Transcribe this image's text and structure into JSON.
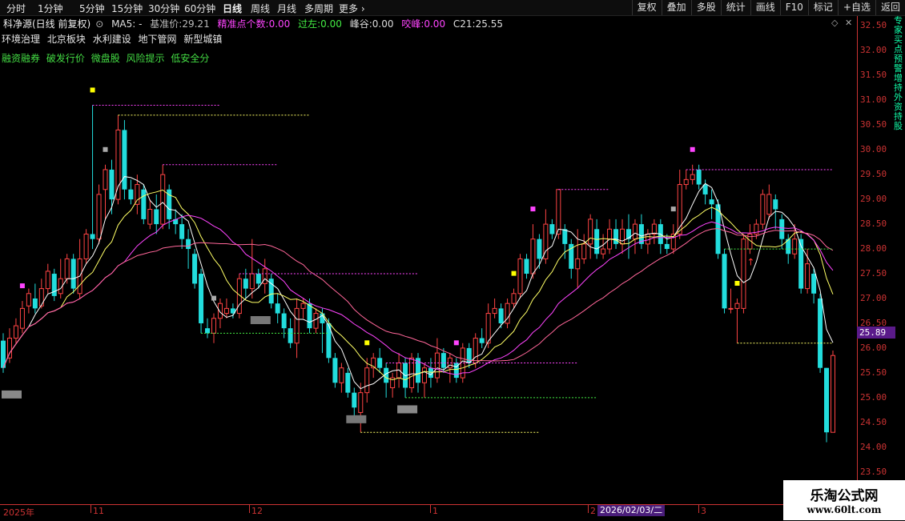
{
  "toolbar": {
    "periods": [
      "分时",
      "1分钟",
      "5分钟",
      "15分钟",
      "30分钟",
      "60分钟",
      "日线",
      "周线",
      "月线",
      "多周期",
      "更多"
    ],
    "buttons": [
      "复权",
      "叠加",
      "多股",
      "统计",
      "画线",
      "F10",
      "标记",
      "+自选",
      "返回"
    ]
  },
  "info": {
    "stock": "科净源(日线 前复权)",
    "ma5": "MA5: -",
    "base_label": "基准价:",
    "base_value": "29.21",
    "precise_label": "精准点个数:",
    "precise_value": "0.00",
    "over_label": "过左:",
    "over_value": "0.00",
    "peak_label": "峰谷:",
    "peak_value": "0.00",
    "bite_label": "咬峰:",
    "bite_value": "0.00",
    "c21_label": "C21:",
    "c21_value": "25.55"
  },
  "tags": [
    "环境治理",
    "北京板块",
    "水利建设",
    "地下管网",
    "新型城镇"
  ],
  "tags2": [
    "融资融券",
    "破发行价",
    "微盘股",
    "风险提示",
    "低安全分"
  ],
  "yaxis": [
    "32.50",
    "32.00",
    "31.50",
    "31.00",
    "30.50",
    "30.00",
    "29.50",
    "29.00",
    "28.50",
    "28.00",
    "27.50",
    "27.00",
    "26.50",
    "26.00",
    "25.50",
    "25.00",
    "24.50",
    "24.00",
    "23.50",
    "23.00"
  ],
  "current_price": "25.89",
  "xaxis": {
    "labels": [
      "2025年",
      "11",
      "12",
      "1",
      "2",
      "3"
    ],
    "highlight": "2026/02/03/二"
  },
  "side_text": "专家买点预警增持外资持股",
  "watermark": {
    "line1": "乐淘公式网",
    "line2": "www.60lt.com"
  },
  "colors": {
    "up": "#ff4444",
    "down": "#22dddd",
    "ma5": "#ffffff",
    "ma10": "#ffff66",
    "ma20": "#ff44ff",
    "ma30": "#ff6699"
  },
  "chart_data": {
    "type": "candlestick",
    "ylim": [
      22.85,
      32.7
    ],
    "candles": [
      {
        "o": 26.15,
        "c": 25.6,
        "h": 26.3,
        "l": 25.5
      },
      {
        "o": 25.8,
        "c": 26.2,
        "h": 26.4,
        "l": 25.7
      },
      {
        "o": 26.2,
        "c": 26.45,
        "h": 26.6,
        "l": 26.1
      },
      {
        "o": 26.4,
        "c": 26.8,
        "h": 26.95,
        "l": 26.3
      },
      {
        "o": 26.85,
        "c": 27.1,
        "h": 27.2,
        "l": 26.7
      },
      {
        "o": 27.0,
        "c": 26.8,
        "h": 27.3,
        "l": 26.7
      },
      {
        "o": 26.85,
        "c": 27.2,
        "h": 27.4,
        "l": 26.8
      },
      {
        "o": 27.2,
        "c": 27.55,
        "h": 27.7,
        "l": 27.1
      },
      {
        "o": 27.5,
        "c": 27.05,
        "h": 27.6,
        "l": 26.95
      },
      {
        "o": 27.1,
        "c": 27.4,
        "h": 27.8,
        "l": 27.0
      },
      {
        "o": 27.4,
        "c": 27.8,
        "h": 27.9,
        "l": 27.3
      },
      {
        "o": 27.8,
        "c": 27.2,
        "h": 27.9,
        "l": 27.1
      },
      {
        "o": 27.1,
        "c": 27.8,
        "h": 28.2,
        "l": 27.0
      },
      {
        "o": 27.8,
        "c": 28.3,
        "h": 28.4,
        "l": 27.7
      },
      {
        "o": 28.3,
        "c": 28.2,
        "h": 30.9,
        "l": 28.0
      },
      {
        "o": 28.2,
        "c": 29.1,
        "h": 29.3,
        "l": 28.1
      },
      {
        "o": 29.2,
        "c": 29.6,
        "h": 29.7,
        "l": 28.6
      },
      {
        "o": 29.6,
        "c": 29.0,
        "h": 29.8,
        "l": 28.7
      },
      {
        "o": 29.0,
        "c": 30.4,
        "h": 30.7,
        "l": 28.9
      },
      {
        "o": 30.4,
        "c": 29.2,
        "h": 30.6,
        "l": 29.0
      },
      {
        "o": 29.2,
        "c": 29.0,
        "h": 29.4,
        "l": 28.9
      },
      {
        "o": 28.9,
        "c": 29.3,
        "h": 29.5,
        "l": 28.7
      },
      {
        "o": 29.2,
        "c": 28.6,
        "h": 29.3,
        "l": 28.5
      },
      {
        "o": 28.5,
        "c": 28.8,
        "h": 29.0,
        "l": 28.4
      },
      {
        "o": 28.8,
        "c": 28.5,
        "h": 29.1,
        "l": 28.3
      },
      {
        "o": 28.5,
        "c": 29.5,
        "h": 29.7,
        "l": 28.4
      },
      {
        "o": 29.2,
        "c": 28.6,
        "h": 29.3,
        "l": 28.4
      },
      {
        "o": 28.6,
        "c": 28.5,
        "h": 28.8,
        "l": 28.3
      },
      {
        "o": 28.5,
        "c": 28.2,
        "h": 28.7,
        "l": 28.0
      },
      {
        "o": 28.2,
        "c": 28.0,
        "h": 28.4,
        "l": 27.6
      },
      {
        "o": 27.9,
        "c": 27.3,
        "h": 28.0,
        "l": 27.2
      },
      {
        "o": 27.5,
        "c": 26.5,
        "h": 27.6,
        "l": 26.3
      },
      {
        "o": 26.4,
        "c": 26.3,
        "h": 26.6,
        "l": 26.2
      },
      {
        "o": 26.3,
        "c": 26.6,
        "h": 26.7,
        "l": 26.1
      },
      {
        "o": 26.6,
        "c": 26.9,
        "h": 27.0,
        "l": 26.4
      },
      {
        "o": 26.7,
        "c": 26.8,
        "h": 27.0,
        "l": 26.6
      },
      {
        "o": 26.8,
        "c": 26.7,
        "h": 26.9,
        "l": 26.6
      },
      {
        "o": 26.7,
        "c": 27.4,
        "h": 27.5,
        "l": 26.6
      },
      {
        "o": 27.4,
        "c": 27.2,
        "h": 27.6,
        "l": 27.0
      },
      {
        "o": 27.2,
        "c": 27.5,
        "h": 28.2,
        "l": 27.0
      },
      {
        "o": 27.5,
        "c": 27.3,
        "h": 27.6,
        "l": 27.2
      },
      {
        "o": 27.3,
        "c": 27.6,
        "h": 27.8,
        "l": 27.1
      },
      {
        "o": 27.4,
        "c": 26.9,
        "h": 27.5,
        "l": 26.8
      },
      {
        "o": 26.9,
        "c": 26.7,
        "h": 27.1,
        "l": 26.5
      },
      {
        "o": 26.7,
        "c": 26.4,
        "h": 26.8,
        "l": 26.2
      },
      {
        "o": 26.4,
        "c": 26.1,
        "h": 26.6,
        "l": 26.0
      },
      {
        "o": 26.1,
        "c": 26.8,
        "h": 27.0,
        "l": 25.8
      },
      {
        "o": 26.8,
        "c": 26.9,
        "h": 27.0,
        "l": 26.6
      },
      {
        "o": 26.9,
        "c": 26.4,
        "h": 27.0,
        "l": 26.3
      },
      {
        "o": 26.4,
        "c": 26.7,
        "h": 26.8,
        "l": 26.3
      },
      {
        "o": 26.7,
        "c": 26.5,
        "h": 26.8,
        "l": 25.9
      },
      {
        "o": 26.5,
        "c": 25.8,
        "h": 26.6,
        "l": 25.7
      },
      {
        "o": 25.8,
        "c": 25.3,
        "h": 25.9,
        "l": 25.2
      },
      {
        "o": 25.3,
        "c": 25.6,
        "h": 25.7,
        "l": 25.1
      },
      {
        "o": 25.5,
        "c": 25.1,
        "h": 25.6,
        "l": 25.0
      },
      {
        "o": 25.1,
        "c": 24.8,
        "h": 25.2,
        "l": 24.6
      },
      {
        "o": 24.7,
        "c": 25.1,
        "h": 25.3,
        "l": 24.3
      },
      {
        "o": 25.1,
        "c": 25.6,
        "h": 25.8,
        "l": 24.9
      },
      {
        "o": 25.6,
        "c": 25.8,
        "h": 25.9,
        "l": 25.4
      },
      {
        "o": 25.8,
        "c": 25.6,
        "h": 26.0,
        "l": 25.5
      },
      {
        "o": 25.6,
        "c": 25.3,
        "h": 25.7,
        "l": 25.0
      },
      {
        "o": 25.2,
        "c": 25.4,
        "h": 25.5,
        "l": 25.0
      },
      {
        "o": 25.4,
        "c": 25.7,
        "h": 25.9,
        "l": 25.2
      },
      {
        "o": 25.7,
        "c": 25.2,
        "h": 25.8,
        "l": 25.0
      },
      {
        "o": 25.2,
        "c": 25.8,
        "h": 25.9,
        "l": 25.1
      },
      {
        "o": 25.8,
        "c": 25.3,
        "h": 25.9,
        "l": 25.1
      },
      {
        "o": 25.3,
        "c": 25.6,
        "h": 25.7,
        "l": 25.0
      },
      {
        "o": 25.6,
        "c": 25.4,
        "h": 25.8,
        "l": 25.2
      },
      {
        "o": 25.4,
        "c": 25.9,
        "h": 26.2,
        "l": 25.3
      },
      {
        "o": 25.9,
        "c": 25.6,
        "h": 26.0,
        "l": 25.5
      },
      {
        "o": 25.6,
        "c": 25.8,
        "h": 25.9,
        "l": 25.3
      },
      {
        "o": 25.7,
        "c": 25.4,
        "h": 25.8,
        "l": 25.3
      },
      {
        "o": 25.4,
        "c": 26.0,
        "h": 26.1,
        "l": 25.3
      },
      {
        "o": 26.0,
        "c": 25.7,
        "h": 26.1,
        "l": 25.6
      },
      {
        "o": 25.7,
        "c": 26.2,
        "h": 26.3,
        "l": 25.6
      },
      {
        "o": 26.2,
        "c": 26.1,
        "h": 26.4,
        "l": 26.0
      },
      {
        "o": 26.1,
        "c": 26.7,
        "h": 26.9,
        "l": 26.0
      },
      {
        "o": 26.7,
        "c": 26.8,
        "h": 27.0,
        "l": 26.6
      },
      {
        "o": 26.8,
        "c": 26.5,
        "h": 26.9,
        "l": 26.4
      },
      {
        "o": 26.5,
        "c": 26.9,
        "h": 27.0,
        "l": 26.4
      },
      {
        "o": 26.9,
        "c": 27.1,
        "h": 27.2,
        "l": 26.8
      },
      {
        "o": 27.1,
        "c": 27.8,
        "h": 27.9,
        "l": 27.0
      },
      {
        "o": 27.8,
        "c": 27.5,
        "h": 27.9,
        "l": 27.4
      },
      {
        "o": 27.5,
        "c": 28.2,
        "h": 28.5,
        "l": 27.4
      },
      {
        "o": 28.2,
        "c": 27.8,
        "h": 28.3,
        "l": 27.6
      },
      {
        "o": 27.8,
        "c": 28.5,
        "h": 28.8,
        "l": 27.7
      },
      {
        "o": 28.5,
        "c": 28.3,
        "h": 28.6,
        "l": 28.2
      },
      {
        "o": 28.3,
        "c": 29.2,
        "h": 29.2,
        "l": 28.2
      },
      {
        "o": 28.4,
        "c": 28.1,
        "h": 28.5,
        "l": 27.8
      },
      {
        "o": 28.1,
        "c": 27.6,
        "h": 28.2,
        "l": 27.4
      },
      {
        "o": 27.6,
        "c": 27.8,
        "h": 28.4,
        "l": 27.2
      },
      {
        "o": 27.8,
        "c": 28.1,
        "h": 28.3,
        "l": 27.7
      },
      {
        "o": 28.1,
        "c": 28.6,
        "h": 28.7,
        "l": 27.8
      },
      {
        "o": 28.4,
        "c": 27.9,
        "h": 28.6,
        "l": 27.8
      },
      {
        "o": 27.9,
        "c": 28.0,
        "h": 28.3,
        "l": 27.8
      },
      {
        "o": 28.0,
        "c": 28.4,
        "h": 28.6,
        "l": 27.9
      },
      {
        "o": 28.4,
        "c": 28.1,
        "h": 28.6,
        "l": 28.0
      },
      {
        "o": 28.1,
        "c": 28.4,
        "h": 28.6,
        "l": 27.9
      },
      {
        "o": 28.4,
        "c": 28.2,
        "h": 28.7,
        "l": 27.8
      },
      {
        "o": 28.2,
        "c": 28.5,
        "h": 28.6,
        "l": 27.9
      },
      {
        "o": 28.5,
        "c": 28.1,
        "h": 28.7,
        "l": 28.0
      },
      {
        "o": 28.1,
        "c": 28.3,
        "h": 28.4,
        "l": 27.9
      },
      {
        "o": 28.3,
        "c": 28.5,
        "h": 28.6,
        "l": 28.1
      },
      {
        "o": 28.5,
        "c": 28.1,
        "h": 28.6,
        "l": 27.9
      },
      {
        "o": 28.1,
        "c": 28.0,
        "h": 28.3,
        "l": 27.9
      },
      {
        "o": 28.0,
        "c": 28.3,
        "h": 28.5,
        "l": 27.9
      },
      {
        "o": 28.3,
        "c": 29.3,
        "h": 29.6,
        "l": 28.2
      },
      {
        "o": 29.3,
        "c": 29.4,
        "h": 29.6,
        "l": 29.2
      },
      {
        "o": 29.4,
        "c": 29.5,
        "h": 29.7,
        "l": 29.3
      },
      {
        "o": 29.6,
        "c": 29.3,
        "h": 29.7,
        "l": 29.2
      },
      {
        "o": 29.3,
        "c": 29.1,
        "h": 29.4,
        "l": 28.9
      },
      {
        "o": 29.0,
        "c": 28.9,
        "h": 29.2,
        "l": 28.6
      },
      {
        "o": 28.9,
        "c": 27.9,
        "h": 29.0,
        "l": 27.8
      },
      {
        "o": 27.9,
        "c": 26.8,
        "h": 28.0,
        "l": 26.7
      },
      {
        "o": 26.8,
        "c": 26.8,
        "h": 27.2,
        "l": 26.7
      },
      {
        "o": 26.8,
        "c": 26.9,
        "h": 27.0,
        "l": 26.1
      },
      {
        "o": 26.8,
        "c": 28.2,
        "h": 28.3,
        "l": 26.7
      },
      {
        "o": 28.0,
        "c": 28.3,
        "h": 28.5,
        "l": 27.9
      },
      {
        "o": 28.3,
        "c": 28.5,
        "h": 28.6,
        "l": 28.2
      },
      {
        "o": 28.5,
        "c": 29.1,
        "h": 29.2,
        "l": 28.4
      },
      {
        "o": 28.7,
        "c": 29.1,
        "h": 29.3,
        "l": 28.6
      },
      {
        "o": 29.0,
        "c": 28.8,
        "h": 29.1,
        "l": 28.4
      },
      {
        "o": 28.6,
        "c": 28.2,
        "h": 28.7,
        "l": 28.0
      },
      {
        "o": 28.2,
        "c": 27.9,
        "h": 28.3,
        "l": 27.7
      },
      {
        "o": 27.9,
        "c": 28.2,
        "h": 28.5,
        "l": 27.8
      },
      {
        "o": 28.2,
        "c": 27.2,
        "h": 28.3,
        "l": 27.1
      },
      {
        "o": 27.2,
        "c": 27.7,
        "h": 28.0,
        "l": 27.1
      },
      {
        "o": 27.5,
        "c": 27.1,
        "h": 27.6,
        "l": 26.9
      },
      {
        "o": 27.0,
        "c": 25.6,
        "h": 27.1,
        "l": 25.5
      },
      {
        "o": 25.6,
        "c": 24.3,
        "h": 25.6,
        "l": 24.1
      },
      {
        "o": 24.3,
        "c": 25.85,
        "h": 25.95,
        "l": 24.4
      }
    ]
  }
}
